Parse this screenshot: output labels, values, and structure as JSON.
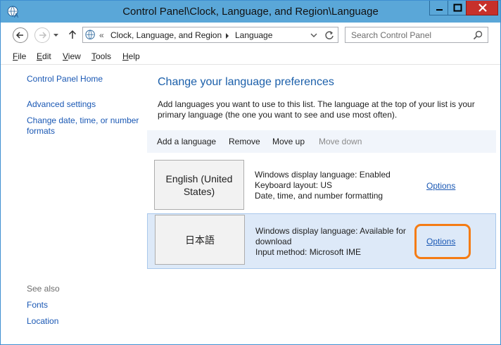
{
  "window": {
    "title": "Control Panel\\Clock, Language, and Region\\Language"
  },
  "toolbar": {
    "breadcrumb": [
      "Clock, Language, and Region",
      "Language"
    ],
    "breadcrumb_prefix": "«",
    "search_placeholder": "Search Control Panel"
  },
  "menu": {
    "items": [
      {
        "label": "File",
        "accel": "F",
        "rest": "ile"
      },
      {
        "label": "Edit",
        "accel": "E",
        "rest": "dit"
      },
      {
        "label": "View",
        "accel": "V",
        "rest": "iew"
      },
      {
        "label": "Tools",
        "accel": "T",
        "rest": "ools"
      },
      {
        "label": "Help",
        "accel": "H",
        "rest": "elp"
      }
    ]
  },
  "sidebar": {
    "home": "Control Panel Home",
    "advanced": "Advanced settings",
    "change_date_1": "Change date, time, or number",
    "change_date_2": "formats",
    "see_also": "See also",
    "fonts": "Fonts",
    "location": "Location"
  },
  "main": {
    "title": "Change your language preferences",
    "desc_1": "Add languages you want to use to this list. The language at the top of your list is your",
    "desc_2": "primary language (the one you want to see and use most often).",
    "commands": {
      "add": "Add a language",
      "remove": "Remove",
      "up": "Move up",
      "down": "Move down"
    },
    "languages": [
      {
        "name_1": "English (United",
        "name_2": "States)",
        "info_1": "Windows display language: Enabled",
        "info_2": "Keyboard layout: US",
        "info_3": "Date, time, and number formatting",
        "options": "Options"
      },
      {
        "name_1": "日本語",
        "name_2": "",
        "info_1": "Windows display language: Available for",
        "info_2": "download",
        "info_3": "Input method: Microsoft IME",
        "options": "Options"
      }
    ]
  },
  "colors": {
    "titlebar": "#5aa7d8",
    "link": "#1a58b4",
    "highlight": "#f57c14"
  }
}
